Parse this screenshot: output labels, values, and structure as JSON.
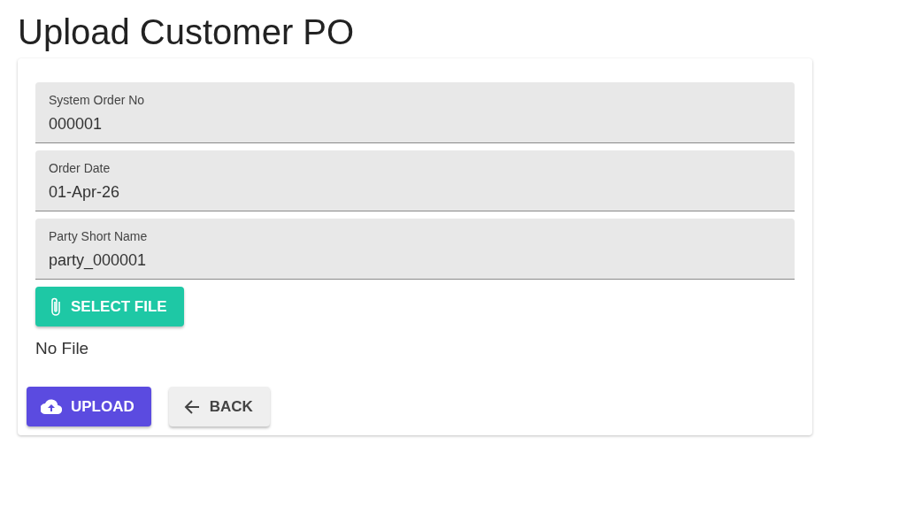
{
  "title": "Upload Customer PO",
  "fields": [
    {
      "label": "System Order No",
      "value": "000001"
    },
    {
      "label": "Order Date",
      "value": "01-Apr-26"
    },
    {
      "label": "Party Short Name",
      "value": "party_000001"
    }
  ],
  "select_file_button": "SELECT FILE",
  "file_status": "No File",
  "actions": [
    {
      "kind": "primary",
      "label": "UPLOAD"
    },
    {
      "kind": "secondary",
      "label": "BACK"
    }
  ]
}
